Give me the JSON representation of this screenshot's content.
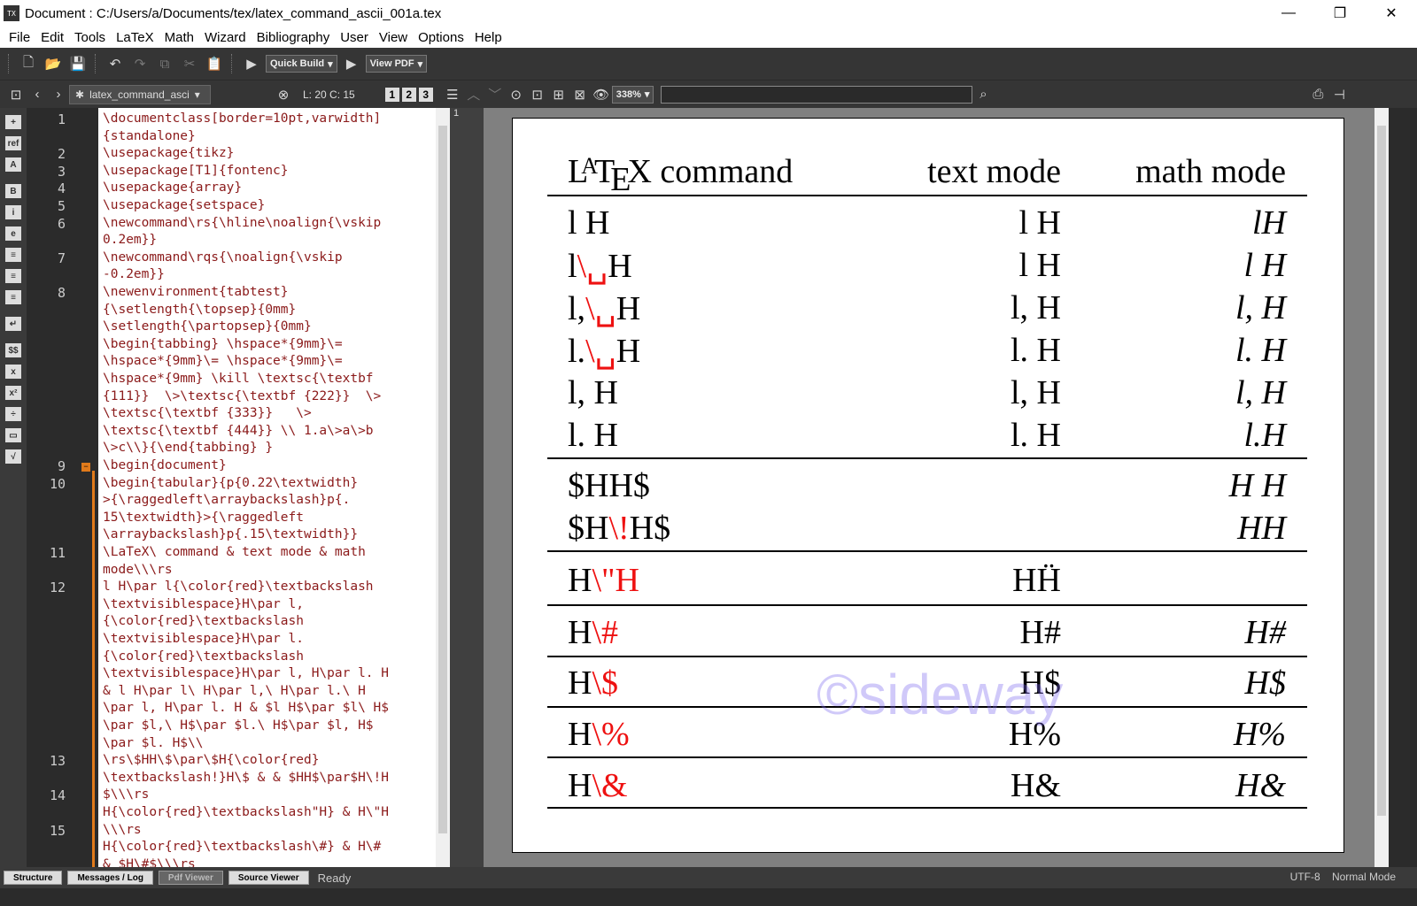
{
  "window": {
    "title": "Document : C:/Users/a/Documents/tex/latex_command_ascii_001a.tex",
    "minimize": "—",
    "maximize": "❐",
    "close": "✕"
  },
  "menu": [
    "File",
    "Edit",
    "Tools",
    "LaTeX",
    "Math",
    "Wizard",
    "Bibliography",
    "User",
    "View",
    "Options",
    "Help"
  ],
  "toolbar": {
    "build_label": "Quick Build",
    "view_label": "View PDF"
  },
  "tabbar": {
    "tab_label": "latex_command_asci",
    "linecol": "L: 20 C: 15",
    "zoom": "338%",
    "views": [
      "1",
      "2",
      "3"
    ]
  },
  "editor": {
    "line_numbers": [
      {
        "n": "1",
        "row": 0
      },
      {
        "n": "2",
        "row": 2
      },
      {
        "n": "3",
        "row": 3
      },
      {
        "n": "4",
        "row": 4
      },
      {
        "n": "5",
        "row": 5
      },
      {
        "n": "6",
        "row": 6
      },
      {
        "n": "7",
        "row": 8
      },
      {
        "n": "8",
        "row": 10
      },
      {
        "n": "9",
        "row": 20
      },
      {
        "n": "10",
        "row": 21
      },
      {
        "n": "11",
        "row": 25
      },
      {
        "n": "12",
        "row": 27
      },
      {
        "n": "13",
        "row": 37
      },
      {
        "n": "14",
        "row": 39
      },
      {
        "n": "15",
        "row": 41
      }
    ],
    "lines": [
      "\\documentclass[border=10pt,varwidth]",
      "{standalone}",
      "\\usepackage{tikz}",
      "\\usepackage[T1]{fontenc}",
      "\\usepackage{array}",
      "\\usepackage{setspace}",
      "\\newcommand\\rs{\\hline\\noalign{\\vskip",
      "0.2em}}",
      "\\newcommand\\rqs{\\noalign{\\vskip",
      "-0.2em}}",
      "\\newenvironment{tabtest}",
      "{\\setlength{\\topsep}{0mm}",
      "\\setlength{\\partopsep}{0mm}",
      "\\begin{tabbing} \\hspace*{9mm}\\=",
      "\\hspace*{9mm}\\= \\hspace*{9mm}\\=",
      "\\hspace*{9mm} \\kill \\textsc{\\textbf",
      "{111}}  \\>\\textsc{\\textbf {222}}  \\>",
      "\\textsc{\\textbf {333}}   \\>",
      "\\textsc{\\textbf {444}} \\\\ 1.a\\>a\\>b",
      "\\>c\\\\}{\\end{tabbing} }",
      "\\begin{document}",
      "\\begin{tabular}{p{0.22\\textwidth}",
      ">{\\raggedleft\\arraybackslash}p{.",
      "15\\textwidth}>{\\raggedleft",
      "\\arraybackslash}p{.15\\textwidth}}",
      "\\LaTeX\\ command & text mode & math",
      "mode\\\\\\rs",
      "l H\\par l{\\color{red}\\textbackslash",
      "\\textvisiblespace}H\\par l,",
      "{\\color{red}\\textbackslash",
      "\\textvisiblespace}H\\par l.",
      "{\\color{red}\\textbackslash",
      "\\textvisiblespace}H\\par l, H\\par l. H",
      "& l H\\par l\\ H\\par l,\\ H\\par l.\\ H",
      "\\par l, H\\par l. H & $l H$\\par $l\\ H$",
      "\\par $l,\\ H$\\par $l.\\ H$\\par $l, H$",
      "\\par $l. H$\\\\",
      "\\rs\\$HH\\$\\par\\$H{\\color{red}",
      "\\textbackslash!}H\\$ & & $HH$\\par$H\\!H",
      "$\\\\\\rs",
      "H{\\color{red}\\textbackslash\"H} & H\\\"H",
      "\\\\\\rs",
      "H{\\color{red}\\textbackslash\\#} & H\\#",
      "& $H\\#$\\\\\\rs"
    ]
  },
  "pdf": {
    "page_number": "1",
    "header": {
      "latex": "L",
      "latex_a": "A",
      "latex_t": "T",
      "latex_e": "E",
      "latex_x": "X",
      "command": "command",
      "text_mode": "text mode",
      "math_mode": "math mode"
    },
    "rows": [
      {
        "cmd": "l H",
        "cmd_red": "",
        "cmd_tail": "",
        "text": "l H",
        "math": "lH"
      },
      {
        "cmd": "l",
        "cmd_red": "\\␣",
        "cmd_tail": "H",
        "text": "l H",
        "math": "l  H"
      },
      {
        "cmd": "l,",
        "cmd_red": "\\␣",
        "cmd_tail": "H",
        "text": "l, H",
        "math": "l,  H"
      },
      {
        "cmd": "l.",
        "cmd_red": "\\␣",
        "cmd_tail": "H",
        "text": "l. H",
        "math": "l.  H"
      },
      {
        "cmd": "l, H",
        "cmd_red": "",
        "cmd_tail": "",
        "text": "l, H",
        "math": "l, H"
      },
      {
        "cmd": "l.  H",
        "cmd_red": "",
        "cmd_tail": "",
        "text": "l.  H",
        "math": "l.H"
      },
      {
        "cmd": "$HH$",
        "cmd_red": "",
        "cmd_tail": "",
        "text": "",
        "math": "H H"
      },
      {
        "cmd": "$H",
        "cmd_red": "\\!",
        "cmd_tail": "H$",
        "text": "",
        "math": "HH"
      },
      {
        "cmd": "H",
        "cmd_red": "\\\"H",
        "cmd_tail": "",
        "text": "HḦ",
        "math": ""
      },
      {
        "cmd": "H",
        "cmd_red": "\\#",
        "cmd_tail": "",
        "text": "H#",
        "math": "H#"
      },
      {
        "cmd": "H",
        "cmd_red": "\\$",
        "cmd_tail": "",
        "text": "H$",
        "math": "H$"
      },
      {
        "cmd": "H",
        "cmd_red": "\\%",
        "cmd_tail": "",
        "text": "H%",
        "math": "H%"
      },
      {
        "cmd": "H",
        "cmd_red": "\\&",
        "cmd_tail": "",
        "text": "H&",
        "math": "H&"
      }
    ],
    "watermark": "©sideway"
  },
  "status": {
    "tabs": [
      "Structure",
      "Messages / Log",
      "Pdf Viewer",
      "Source Viewer"
    ],
    "state": "Ready",
    "encoding": "UTF-8",
    "mode": "Normal Mode"
  },
  "left_icons": [
    "+",
    "ref",
    "A",
    "B",
    "i",
    "e",
    "≡",
    "≡",
    "≡",
    "↵",
    "$$",
    "x",
    "x²",
    "÷",
    "▭",
    "√"
  ],
  "colors": {
    "accent_red": "#ee1111",
    "fold_orange": "#e07a1b",
    "dark_bg": "#353535"
  }
}
